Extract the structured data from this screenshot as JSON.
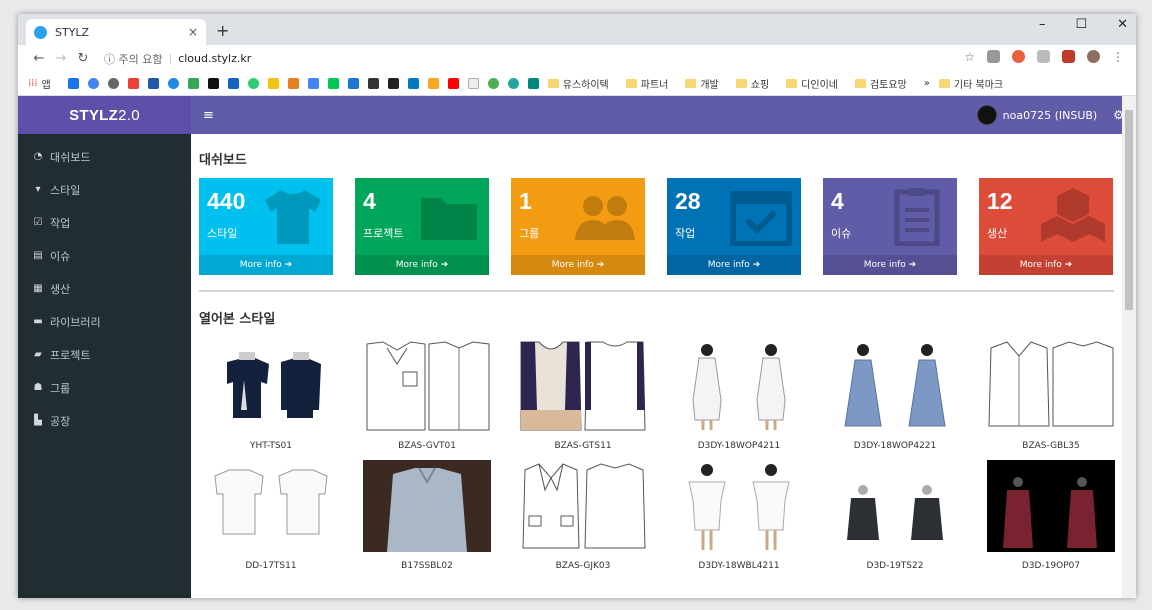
{
  "browser": {
    "tab_title": "STYLZ",
    "tab_close": "×",
    "new_tab": "+",
    "window_controls": [
      "–",
      "☐",
      "✕"
    ],
    "security_label": "ⓘ 주의 요함",
    "url": "cloud.stylz.kr",
    "bookmarks_apps": "앱",
    "bookmark_folders": [
      "유스하이텍",
      "파트너",
      "개발",
      "쇼핑",
      "디인이네",
      "검토요망"
    ],
    "more_bookmarks": "»",
    "other_bookmarks": "기타 북마크"
  },
  "app": {
    "logo_main": "STYLZ",
    "logo_version": "2.0",
    "hamburger": "≡",
    "user_name": "noa0725 (INSUB)"
  },
  "sidebar": {
    "items": [
      {
        "label": "대쉬보드",
        "icon": "dashboard-icon"
      },
      {
        "label": "스타일",
        "icon": "tshirt-icon"
      },
      {
        "label": "작업",
        "icon": "calendar-check-icon"
      },
      {
        "label": "이슈",
        "icon": "clipboard-icon"
      },
      {
        "label": "생산",
        "icon": "cubes-icon"
      },
      {
        "label": "라이브러리",
        "icon": "book-icon"
      },
      {
        "label": "프로젝트",
        "icon": "folder-icon"
      },
      {
        "label": "그룹",
        "icon": "users-icon"
      },
      {
        "label": "공장",
        "icon": "industry-icon"
      }
    ]
  },
  "dashboard": {
    "title": "대쉬보드",
    "boxes": [
      {
        "value": "440",
        "label": "스타일",
        "more": "More info ➔",
        "color": "#00c0ef",
        "icon": "tshirt-icon"
      },
      {
        "value": "4",
        "label": "프로젝트",
        "more": "More info ➔",
        "color": "#00a65a",
        "icon": "folder-icon"
      },
      {
        "value": "1",
        "label": "그룹",
        "more": "More info ➔",
        "color": "#f39c12",
        "icon": "users-icon"
      },
      {
        "value": "28",
        "label": "작업",
        "more": "More info ➔",
        "color": "#0073b7",
        "icon": "calendar-check-icon"
      },
      {
        "value": "4",
        "label": "이슈",
        "more": "More info ➔",
        "color": "#605ca8",
        "icon": "clipboard-icon"
      },
      {
        "value": "12",
        "label": "생산",
        "more": "More info ➔",
        "color": "#dd4b39",
        "icon": "cubes-icon"
      }
    ]
  },
  "recent_styles": {
    "title": "열어본 스타일",
    "items": [
      {
        "code": "YHT-TS01",
        "kind": "navy-tee-print"
      },
      {
        "code": "BZAS-GVT01",
        "kind": "vest-sketch"
      },
      {
        "code": "BZAS-GTS11",
        "kind": "colorblock-top"
      },
      {
        "code": "D3DY-18WOP4211",
        "kind": "white-dress-model"
      },
      {
        "code": "D3DY-18WOP4221",
        "kind": "blue-dress-model"
      },
      {
        "code": "BZAS-GBL35",
        "kind": "blouse-sketch"
      },
      {
        "code": "DD-17TS11",
        "kind": "white-blouse"
      },
      {
        "code": "B17SSBL02",
        "kind": "grey-shirt-photo"
      },
      {
        "code": "BZAS-GJK03",
        "kind": "jacket-sketch"
      },
      {
        "code": "D3DY-18WBL4211",
        "kind": "offshoulder-model"
      },
      {
        "code": "D3D-19TS22",
        "kind": "dark-top-model"
      },
      {
        "code": "D3D-19OP07",
        "kind": "red-dress-dark"
      }
    ]
  }
}
